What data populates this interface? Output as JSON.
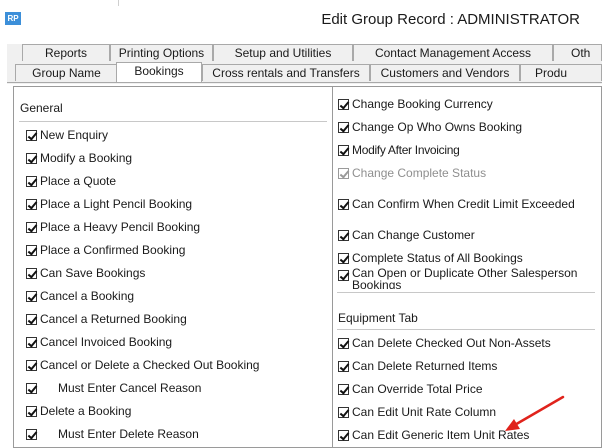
{
  "window": {
    "app_icon_text": "RP",
    "title": "Edit Group Record : ADMINISTRATOR"
  },
  "tabs": {
    "row1": [
      "Reports",
      "Printing Options",
      "Setup and Utilities",
      "Contact Management Access",
      "Oth"
    ],
    "row2": [
      "Group Name",
      "Bookings",
      "Cross rentals and Transfers",
      "Customers and Vendors",
      "Produ"
    ],
    "active": "Bookings"
  },
  "left_panel": {
    "section_title": "General",
    "items": [
      "New Enquiry",
      "Modify a Booking",
      "Place a Quote",
      "Place a Light Pencil Booking",
      "Place a Heavy Pencil Booking",
      "Place a Confirmed Booking",
      "Can Save Bookings",
      "Cancel a Booking",
      "Cancel a Returned Booking",
      "Cancel Invoiced Booking",
      "Cancel or Delete a Checked Out Booking",
      "Must Enter Cancel Reason",
      "Delete a Booking",
      "Must Enter Delete Reason"
    ]
  },
  "right_panel": {
    "items_top": [
      "Change Booking Currency",
      "Change Op Who Owns Booking",
      "Modify After Invoicing",
      "Change Complete Status",
      "Can Confirm When Credit Limit Exceeded",
      "Can Change Customer",
      "Complete Status of All Bookings",
      "Can Open or Duplicate Other Salesperson Bookings"
    ],
    "section_title": "Equipment Tab",
    "items_equipment": [
      "Can Delete Checked Out Non-Assets",
      "Can Delete Returned Items",
      "Can Override Total Price",
      "Can Edit Unit Rate Column",
      "Can Edit Generic Item Unit Rates"
    ]
  },
  "colors": {
    "arrow": "#e0231c",
    "app_icon": "#3c8fd9"
  }
}
